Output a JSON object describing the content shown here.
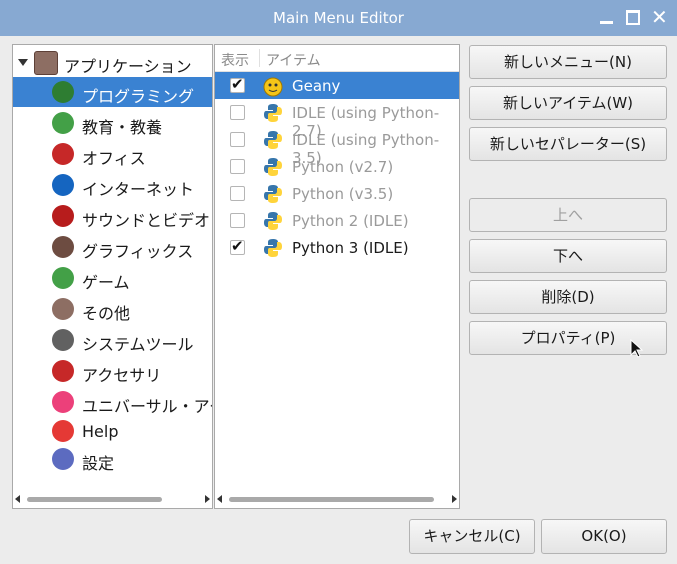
{
  "window": {
    "title": "Main Menu Editor"
  },
  "tree": {
    "root": "アプリケーション",
    "items": [
      {
        "label": "プログラミング",
        "icon": "programming-icon",
        "color": "#2e7d32"
      },
      {
        "label": "教育・教養",
        "icon": "education-icon",
        "color": "#43a047"
      },
      {
        "label": "オフィス",
        "icon": "office-icon",
        "color": "#c62828"
      },
      {
        "label": "インターネット",
        "icon": "internet-icon",
        "color": "#1565c0"
      },
      {
        "label": "サウンドとビデオ",
        "icon": "sound-video-icon",
        "color": "#b71c1c"
      },
      {
        "label": "グラフィックス",
        "icon": "graphics-icon",
        "color": "#6d4c41"
      },
      {
        "label": "ゲーム",
        "icon": "game-icon",
        "color": "#43a047"
      },
      {
        "label": "その他",
        "icon": "other-icon",
        "color": "#8d6e63"
      },
      {
        "label": "システムツール",
        "icon": "system-tools-icon",
        "color": "#616161"
      },
      {
        "label": "アクセサリ",
        "icon": "accessories-icon",
        "color": "#c62828"
      },
      {
        "label": "ユニバーサル・アクセス",
        "icon": "universal-access-icon",
        "color": "#ec407a"
      },
      {
        "label": "Help",
        "icon": "help-icon",
        "color": "#e53935"
      },
      {
        "label": "設定",
        "icon": "settings-icon",
        "color": "#5c6bc0"
      }
    ]
  },
  "list": {
    "col_show": "表示",
    "col_item": "アイテム",
    "rows": [
      {
        "label": "Geany",
        "checked": true,
        "dim": false
      },
      {
        "label": "IDLE (using Python-2.7)",
        "checked": false,
        "dim": true
      },
      {
        "label": "IDLE (using Python-3.5)",
        "checked": false,
        "dim": true
      },
      {
        "label": "Python (v2.7)",
        "checked": false,
        "dim": true
      },
      {
        "label": "Python (v3.5)",
        "checked": false,
        "dim": true
      },
      {
        "label": "Python 2 (IDLE)",
        "checked": false,
        "dim": true
      },
      {
        "label": "Python 3 (IDLE)",
        "checked": true,
        "dim": false
      }
    ]
  },
  "buttons": {
    "new_menu": "新しいメニュー(N)",
    "new_item": "新しいアイテム(W)",
    "new_separator": "新しいセパレーター(S)",
    "up": "上へ",
    "down": "下へ",
    "delete": "削除(D)",
    "properties": "プロパティ(P)",
    "cancel": "キャンセル(C)",
    "ok": "OK(O)"
  },
  "colors": {
    "titlebar": "#87a9d2",
    "selection": "#3a82d2"
  }
}
